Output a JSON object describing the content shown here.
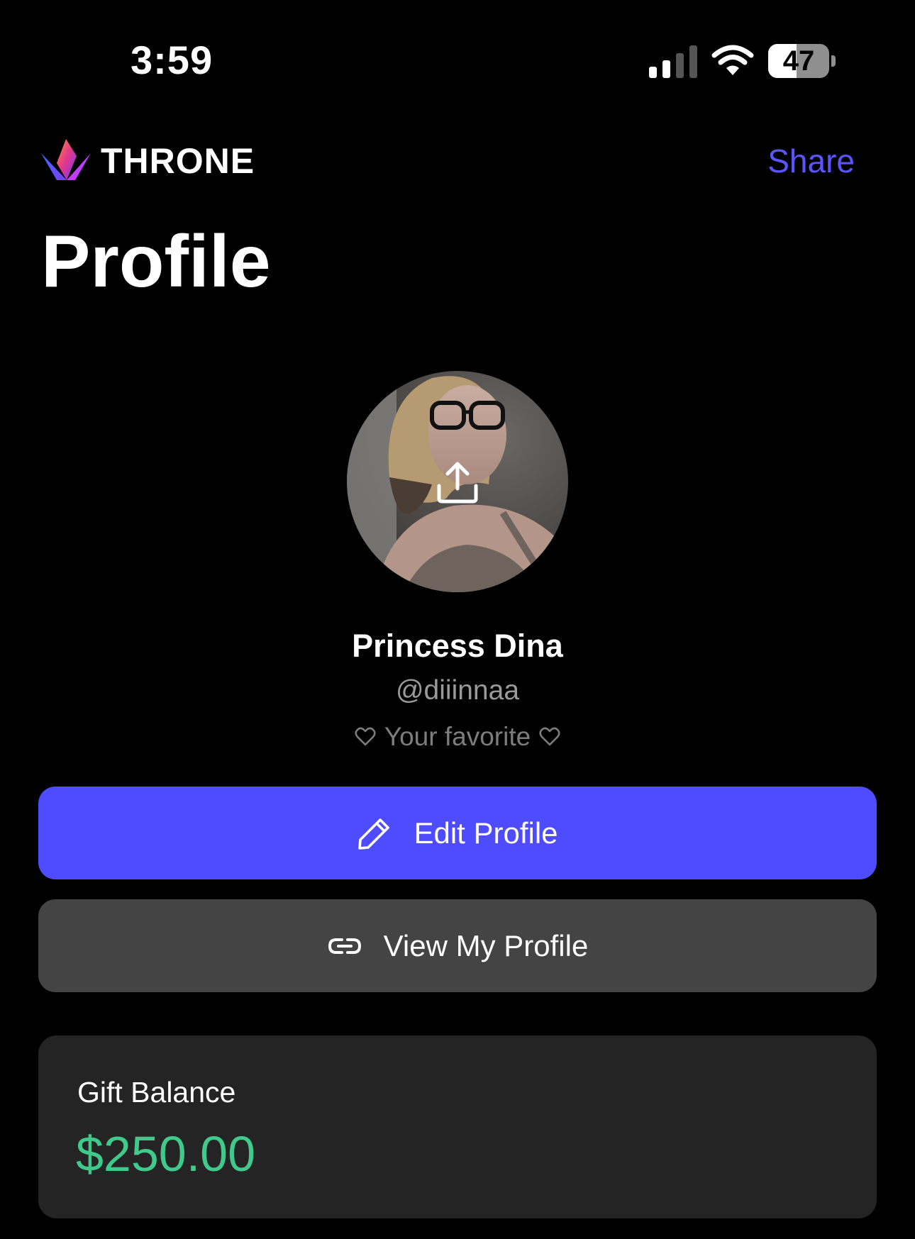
{
  "status_bar": {
    "time": "3:59",
    "battery_level": "47",
    "battery_fraction": 0.47,
    "icons": [
      "signal-icon",
      "wifi-icon",
      "battery-icon"
    ]
  },
  "header": {
    "brand_name": "THRONE",
    "share_label": "Share",
    "page_title": "Profile",
    "logo_icon": "crown-logo-icon"
  },
  "profile": {
    "avatar_icon": "upload-icon",
    "display_name": "Princess Dina",
    "handle": "@diiinnaa",
    "favorite_text": "Your favorite",
    "favorite_icon": "heart-icon"
  },
  "actions": {
    "edit_label": "Edit Profile",
    "edit_icon": "pencil-icon",
    "view_label": "View My Profile",
    "view_icon": "link-icon"
  },
  "balance": {
    "label": "Gift Balance",
    "amount": "$250.00"
  },
  "colors": {
    "background": "#000000",
    "accent": "#4f4bff",
    "share_link": "#5b55ff",
    "secondary_button": "#444444",
    "card": "#242424",
    "money": "#3fc98a",
    "muted_text": "#9a9a9a"
  }
}
